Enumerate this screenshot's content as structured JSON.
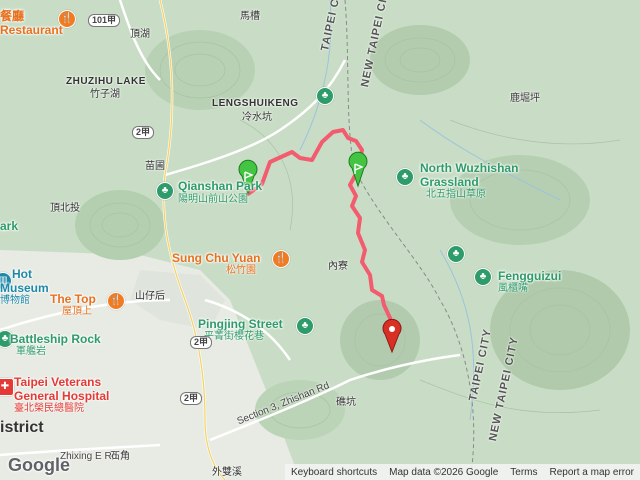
{
  "map": {
    "track_color": "#f25c6e",
    "start_marker_color": "#43c443",
    "end_marker_color": "#d93025"
  },
  "pois": {
    "qianshan_name": "Qianshan Park",
    "qianshan_sub": "陽明山前山公園",
    "north_wuzhishan_name_1": "North Wuzhishan",
    "north_wuzhishan_name_2": "Grassland",
    "north_wuzhishan_sub": "北五指山草原",
    "fengguizui_name": "Fengguizui",
    "fengguizui_sub": "風櫃嘴",
    "sung_chu_yuan_name": "Sung Chu Yuan",
    "sung_chu_yuan_sub": "松竹園",
    "pingjing_name": "Pingjing Street",
    "pingjing_sub": "平菁街櫻花巷",
    "the_top_name": "The Top",
    "the_top_sub": "屋頂上",
    "hot_museum_name_1": "Hot",
    "hot_museum_name_2": "Museum",
    "hot_museum_sub": "博物館",
    "battleship_name": "Battleship Rock",
    "battleship_sub": "軍艦岩",
    "veterans_name_1": "Taipei Veterans",
    "veterans_name_2": "General Hospital",
    "veterans_sub": "臺北榮民總醫院",
    "restaurant_name": "Restaurant",
    "restaurant_sub": "餐廳",
    "park_edge": "ark"
  },
  "places": {
    "zhuzihu_lake": "ZHUZIHU LAKE",
    "zhuzihu_sub": "竹子湖",
    "lengshuikeng": "LENGSHUIKENG",
    "lengshuikeng_sub": "冷水坑",
    "mazao": "馬槽",
    "dinghu": "頂湖",
    "miaopu": "苗圃",
    "dingbeitou": "頂北投",
    "neiliao": "內寮",
    "shanzaihou": "山仔后",
    "luguxi": "鹿堀坪",
    "shikeng": "礁坑",
    "shijiao": "石角",
    "waishuangxi": "外雙溪",
    "district": "istrict"
  },
  "roads": {
    "shield_101": "101甲",
    "shield_2a_1": "2甲",
    "shield_2a_2": "2甲",
    "shield_2a_3": "2甲",
    "zhishan_rd": "Section 3, Zhishan Rd",
    "zhixing_rd": "Zhixing E Rd"
  },
  "city_labels": {
    "taipei_city_1": "TAIPEI CITY",
    "new_taipei_city_1": "NEW TAIPEI CITY",
    "taipei_city_2": "TAIPEI CITY",
    "new_taipei_city_2": "NEW TAIPEI CITY"
  },
  "attribution": {
    "google": "Google",
    "keyboard": "Keyboard shortcuts",
    "map_data": "Map data ©2026 Google",
    "terms": "Terms",
    "report": "Report a map error"
  },
  "icons": {
    "park": "tree",
    "food": "fork-knife",
    "museum": "bank",
    "hospital": "cross",
    "start": "flag-marker",
    "end": "pin-marker"
  }
}
